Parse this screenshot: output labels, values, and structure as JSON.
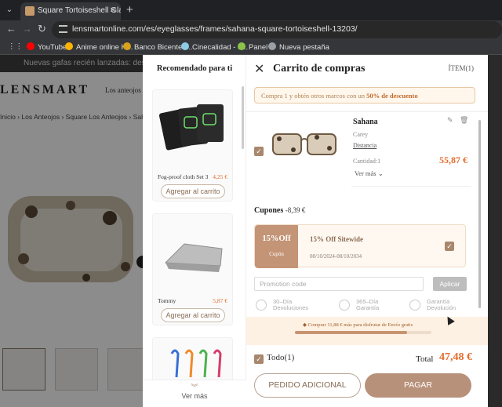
{
  "browser": {
    "tab_title": "Square Tortoiseshell Glasses | S",
    "url": "lensmartonline.com/es/eyeglasses/frames/sahana-square-tortoiseshell-13203/",
    "bookmarks": [
      {
        "label": "YouTube",
        "icon": "youtube-icon",
        "color": "#ff0000"
      },
      {
        "label": "Anime online H...",
        "icon": "anime-icon",
        "color": "#ffb400"
      },
      {
        "label": "Banco Bicenten...",
        "icon": "bank-icon",
        "color": "#d6a21a"
      },
      {
        "label": "Cinecalidad - P...",
        "icon": "cinema-icon",
        "color": "#8ecae6"
      },
      {
        "label": "Panel",
        "icon": "panel-icon",
        "color": "#8bc34a"
      },
      {
        "label": "Nueva pestaña",
        "icon": "globe-icon",
        "color": "#9aa0a6"
      }
    ]
  },
  "page": {
    "announcement": "Nuevas gafas recién lanzadas: descubre lo último",
    "logo": "LENSMART",
    "nav_item": "Los anteojos",
    "breadcrumb": [
      "Inicio",
      "Los Anteojos",
      "Square Los Anteojos",
      "Sahana"
    ]
  },
  "recommended": {
    "title": "Recomendado para ti",
    "items": [
      {
        "name": "Fog-proof cloth Set 3",
        "price": "4,25 €",
        "button": "Agregar al carrito"
      },
      {
        "name": "Tommy",
        "price": "5,87 €",
        "button": "Agregar al carrito"
      }
    ],
    "more": "Ver más"
  },
  "cart": {
    "title": "Carrito de compras",
    "item_count": "ÍTEM(1)",
    "promo_prefix": "Compra 1 y obtén otros marcos con un ",
    "promo_bold": "50% de descuento",
    "item": {
      "name": "Sahana",
      "color": "Carey",
      "type": "Distancia",
      "quantity": "Cantidad:1",
      "price": "55,87 €",
      "more": "Ver más"
    },
    "coupons_label": "Cupones",
    "coupons_discount": "-8,39 €",
    "coupon": {
      "percent": "15%Off",
      "caption": "Cupón",
      "name": "15% Off Sitewide",
      "dates": "08/10/2024-08/10/2034"
    },
    "promo_placeholder": "Promotion code",
    "apply": "Aplicar",
    "guarantees": [
      {
        "line1": "30–Día",
        "line2": "Devoluciones"
      },
      {
        "line1": "365–Día",
        "line2": "Garantía"
      },
      {
        "line1": "Garantía",
        "line2": "Devolución"
      }
    ],
    "shipping_text": "Comprar 11,88 € más para disfrutar de Envío gratis",
    "shipping_progress": 0.82,
    "select_all": "Todo(1)",
    "total_label": "Total",
    "total": "47,48 €",
    "add_order": "PEDIDO ADICIONAL",
    "pay": "PAGAR"
  },
  "colors": {
    "accent": "#b8917a",
    "price": "#e36b2c"
  }
}
